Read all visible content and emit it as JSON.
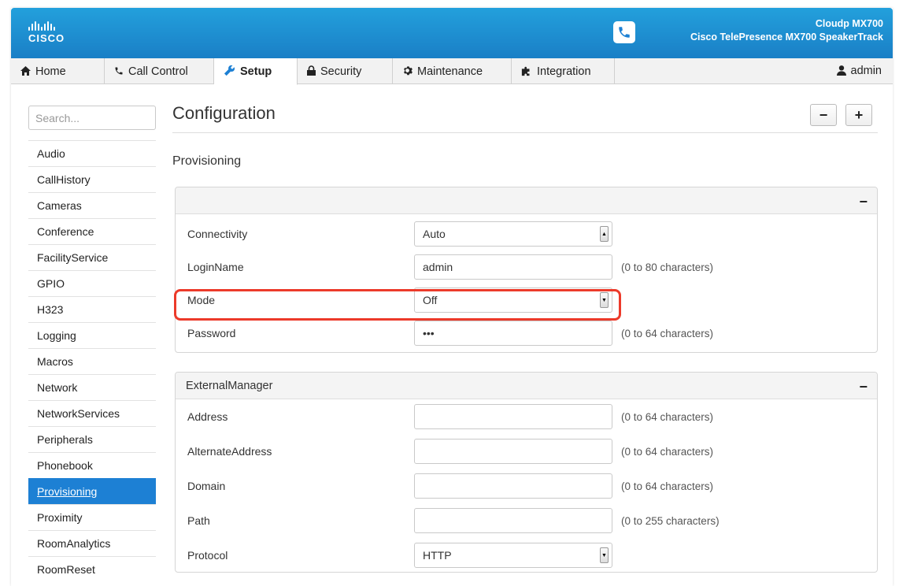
{
  "header": {
    "brand": "CISCO",
    "device_name": "Cloudp MX700",
    "device_model": "Cisco TelePresence MX700 SpeakerTrack",
    "colors": {
      "header": "#1f8fd2",
      "active": "#1d80d4",
      "highlight": "#ec3a2a"
    }
  },
  "nav": {
    "home": "Home",
    "call_control": "Call Control",
    "setup": "Setup",
    "security": "Security",
    "maintenance": "Maintenance",
    "integration": "Integration",
    "user": "admin"
  },
  "sidebar": {
    "search_placeholder": "Search...",
    "items": [
      "Audio",
      "CallHistory",
      "Cameras",
      "Conference",
      "FacilityService",
      "GPIO",
      "H323",
      "Logging",
      "Macros",
      "Network",
      "NetworkServices",
      "Peripherals",
      "Phonebook",
      "Provisioning",
      "Proximity",
      "RoomAnalytics",
      "RoomReset"
    ],
    "active": "Provisioning"
  },
  "main": {
    "title": "Configuration",
    "collapse_all": "−",
    "expand_all": "+",
    "section": "Provisioning",
    "panel1": {
      "header": "",
      "collapse": "−",
      "rows": [
        {
          "label": "Connectivity",
          "value": "Auto",
          "type": "select",
          "hint": ""
        },
        {
          "label": "LoginName",
          "value": "admin",
          "type": "text",
          "hint": "(0 to 80 characters)"
        },
        {
          "label": "Mode",
          "value": "Off",
          "type": "select",
          "hint": ""
        },
        {
          "label": "Password",
          "value": "•••",
          "type": "password",
          "hint": "(0 to 64 characters)"
        }
      ]
    },
    "panel2": {
      "header": "ExternalManager",
      "collapse": "−",
      "rows": [
        {
          "label": "Address",
          "value": "",
          "type": "text",
          "hint": "(0 to 64 characters)"
        },
        {
          "label": "AlternateAddress",
          "value": "",
          "type": "text",
          "hint": "(0 to 64 characters)"
        },
        {
          "label": "Domain",
          "value": "",
          "type": "text",
          "hint": "(0 to 64 characters)"
        },
        {
          "label": "Path",
          "value": "",
          "type": "text",
          "hint": "(0 to 255 characters)"
        },
        {
          "label": "Protocol",
          "value": "HTTP",
          "type": "select",
          "hint": ""
        }
      ]
    }
  }
}
